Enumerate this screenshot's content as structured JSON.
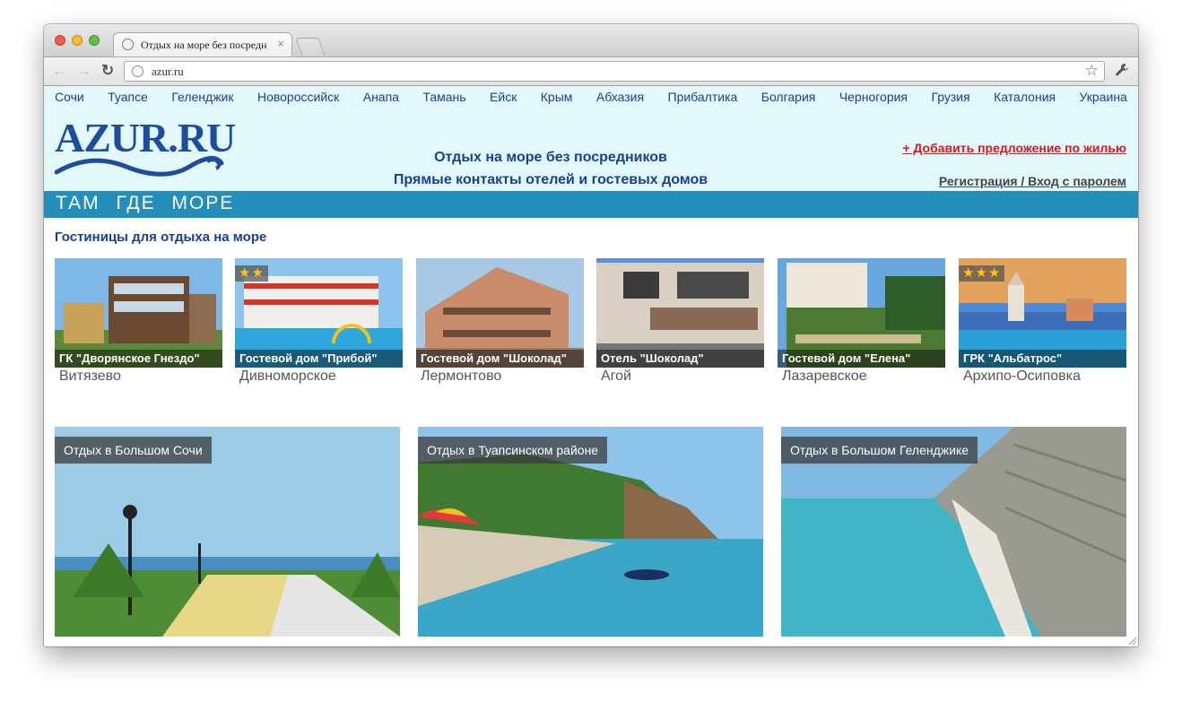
{
  "browser": {
    "tab_title": "Отдых на море без посредн",
    "tab_close": "×",
    "url": "azur.ru",
    "nav_back": "←",
    "nav_forward": "→",
    "nav_reload": "↻",
    "star": "☆",
    "wrench": "🔧"
  },
  "topnav": [
    "Сочи",
    "Туапсе",
    "Геленджик",
    "Новороссийск",
    "Анапа",
    "Тамань",
    "Ейск",
    "Крым",
    "Абхазия",
    "Прибалтика",
    "Болгария",
    "Черногория",
    "Грузия",
    "Каталония",
    "Украина"
  ],
  "header": {
    "logo": "AZUR.RU",
    "slogan_line1": "Отдых на море без посредников",
    "slogan_line2": "Прямые контакты отелей и гостевых домов",
    "add_offer": "+ Добавить предложение по жилью",
    "login": "Регистрация / Вход с паролем",
    "tagline": "ТАМ ГДЕ МОРЕ"
  },
  "hotels_section": {
    "title": "Гостиницы для отдыха на море",
    "items": [
      {
        "name": "ГК \"Дворянское Гнездо\"",
        "town": "Витязево",
        "stars": ""
      },
      {
        "name": "Гостевой дом \"Прибой\"",
        "town": "Дивноморское",
        "stars": "★★"
      },
      {
        "name": "Гостевой дом \"Шоколад\"",
        "town": "Лермонтово",
        "stars": ""
      },
      {
        "name": "Отель \"Шоколад\"",
        "town": "Агой",
        "stars": ""
      },
      {
        "name": "Гостевой дом \"Елена\"",
        "town": "Лазаревское",
        "stars": ""
      },
      {
        "name": "ГРК \"Альбатрос\"",
        "town": "Архипо-Осиповка",
        "stars": "★★★"
      }
    ]
  },
  "regions": [
    {
      "label": "Отдых в Большом Сочи"
    },
    {
      "label": "Отдых в Туапсинском районе"
    },
    {
      "label": "Отдых в Большом Геленджике"
    }
  ],
  "colors": {
    "header_bg": "#e3f8fa",
    "nav_text": "#1b3f8f",
    "bluebar": "#238dbb",
    "add_offer": "#d9171e",
    "star": "#ffc20e"
  }
}
